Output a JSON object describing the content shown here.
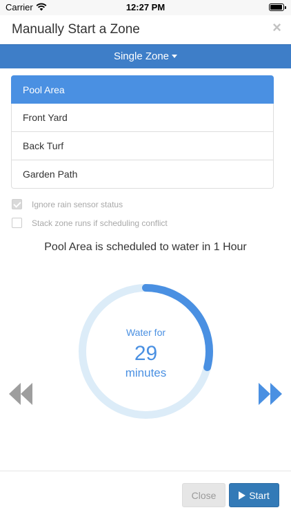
{
  "status_bar": {
    "carrier": "Carrier",
    "time": "12:27 PM",
    "battery_level": 0.95
  },
  "modal": {
    "title": "Manually Start a Zone",
    "close_symbol": "×"
  },
  "mode_selector": {
    "label": "Single Zone"
  },
  "zones": [
    {
      "label": "Pool Area",
      "selected": true
    },
    {
      "label": "Front Yard",
      "selected": false
    },
    {
      "label": "Back Turf",
      "selected": false
    },
    {
      "label": "Garden Path",
      "selected": false
    }
  ],
  "options": {
    "ignore_rain": {
      "label": "Ignore rain sensor status",
      "checked": true
    },
    "stack_runs": {
      "label": "Stack zone runs if scheduling conflict",
      "checked": false
    }
  },
  "schedule_message": "Pool Area is scheduled to water in 1 Hour",
  "timer": {
    "caption": "Water for",
    "value": "29",
    "unit": "minutes",
    "progress_fraction": 0.29
  },
  "footer": {
    "close_label": "Close",
    "start_label": "Start"
  },
  "colors": {
    "primary": "#337ab7",
    "mode_bar": "#3e7ec8",
    "selected_item": "#4a90e2",
    "dial_track": "#dcecf8",
    "dial_progress": "#4a90e2",
    "rewind_arrow": "#9e9e9e",
    "forward_arrow": "#4a90e2"
  },
  "icons": {
    "wifi": "wifi-icon",
    "battery": "battery-icon",
    "close": "close-icon",
    "caret": "caret-down-icon",
    "rewind": "rewind-icon",
    "fast_forward": "fast-forward-icon",
    "play": "play-icon"
  }
}
